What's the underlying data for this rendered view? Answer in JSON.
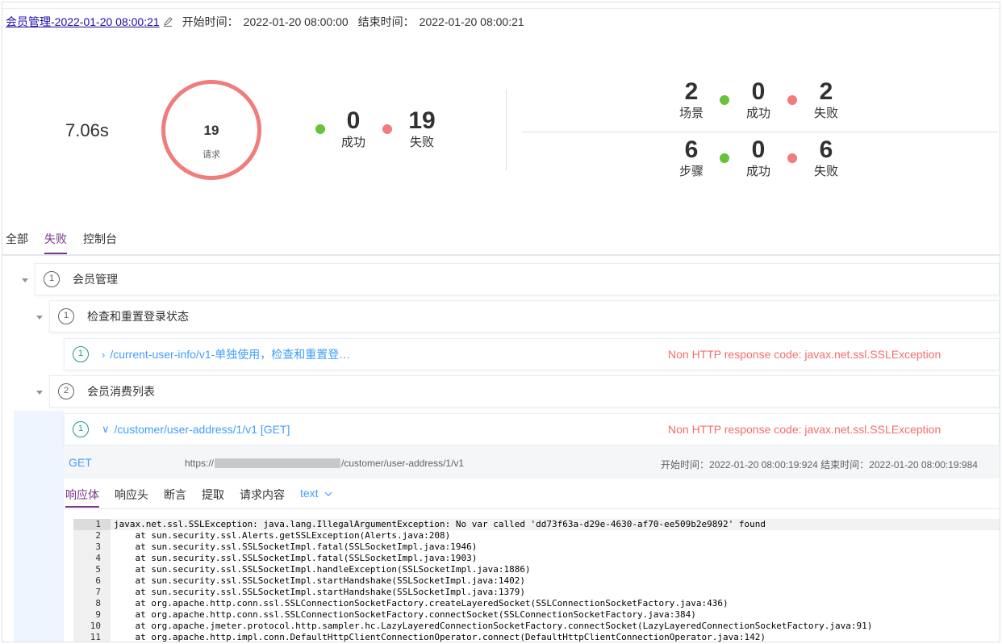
{
  "header": {
    "title": "会员管理-2022-01-20 08:00:21",
    "start_label": "开始时间：",
    "start_value": "2022-01-20 08:00:00",
    "end_label": "结束时间：",
    "end_value": "2022-01-20 08:00:21"
  },
  "summary": {
    "duration": "7.06s",
    "request_count": "19",
    "request_label": "请求",
    "success_count": "0",
    "success_label": "成功",
    "fail_count": "19",
    "fail_label": "失败"
  },
  "scenarios": {
    "total": "2",
    "total_label": "场景",
    "success": "0",
    "success_label": "成功",
    "fail": "2",
    "fail_label": "失败"
  },
  "steps": {
    "total": "6",
    "total_label": "步骤",
    "success": "0",
    "success_label": "成功",
    "fail": "6",
    "fail_label": "失败"
  },
  "colors": {
    "accent": "#783887",
    "success": "#67c23a",
    "fail": "#f07c7c",
    "link": "#409eff",
    "error_text": "#f56c6c"
  },
  "tabs": [
    "全部",
    "失败",
    "控制台"
  ],
  "active_tab": "失败",
  "tree": {
    "scenario": {
      "index": "1",
      "label": "会员管理"
    },
    "group1": {
      "index": "1",
      "label": "检查和重置登录状态"
    },
    "request1": {
      "index": "1",
      "label": "/current-user-info/v1-单独使用，检查和重置登…",
      "error": "Non HTTP response code: javax.net.ssl.SSLException"
    },
    "group2": {
      "index": "2",
      "label": "会员消费列表"
    },
    "request2": {
      "index": "1",
      "label": "/customer/user-address/1/v1 [GET]",
      "error": "Non HTTP response code: javax.net.ssl.SSLException"
    }
  },
  "request_detail": {
    "method": "GET",
    "url_prefix": "https://",
    "url_suffix": "/customer/user-address/1/v1",
    "start_label": "开始时间：",
    "start_value": "2022-01-20 08:00:19:924",
    "end_label": "结束时间：",
    "end_value": "2022-01-20 08:00:19:984"
  },
  "subtabs": [
    "响应体",
    "响应头",
    "断言",
    "提取",
    "请求内容"
  ],
  "format_label": "text",
  "code_lines": [
    "javax.net.ssl.SSLException: java.lang.IllegalArgumentException: No var called 'dd73f63a-d29e-4630-af70-ee509b2e9892' found",
    "    at sun.security.ssl.Alerts.getSSLException(Alerts.java:208)",
    "    at sun.security.ssl.SSLSocketImpl.fatal(SSLSocketImpl.java:1946)",
    "    at sun.security.ssl.SSLSocketImpl.fatal(SSLSocketImpl.java:1903)",
    "    at sun.security.ssl.SSLSocketImpl.handleException(SSLSocketImpl.java:1886)",
    "    at sun.security.ssl.SSLSocketImpl.startHandshake(SSLSocketImpl.java:1402)",
    "    at sun.security.ssl.SSLSocketImpl.startHandshake(SSLSocketImpl.java:1379)",
    "    at org.apache.http.conn.ssl.SSLConnectionSocketFactory.createLayeredSocket(SSLConnectionSocketFactory.java:436)",
    "    at org.apache.http.conn.ssl.SSLConnectionSocketFactory.connectSocket(SSLConnectionSocketFactory.java:384)",
    "    at org.apache.jmeter.protocol.http.sampler.hc.LazyLayeredConnectionSocketFactory.connectSocket(LazyLayeredConnectionSocketFactory.java:91)",
    "    at org.apache.http.impl.conn.DefaultHttpClientConnectionOperator.connect(DefaultHttpClientConnectionOperator.java:142)"
  ]
}
